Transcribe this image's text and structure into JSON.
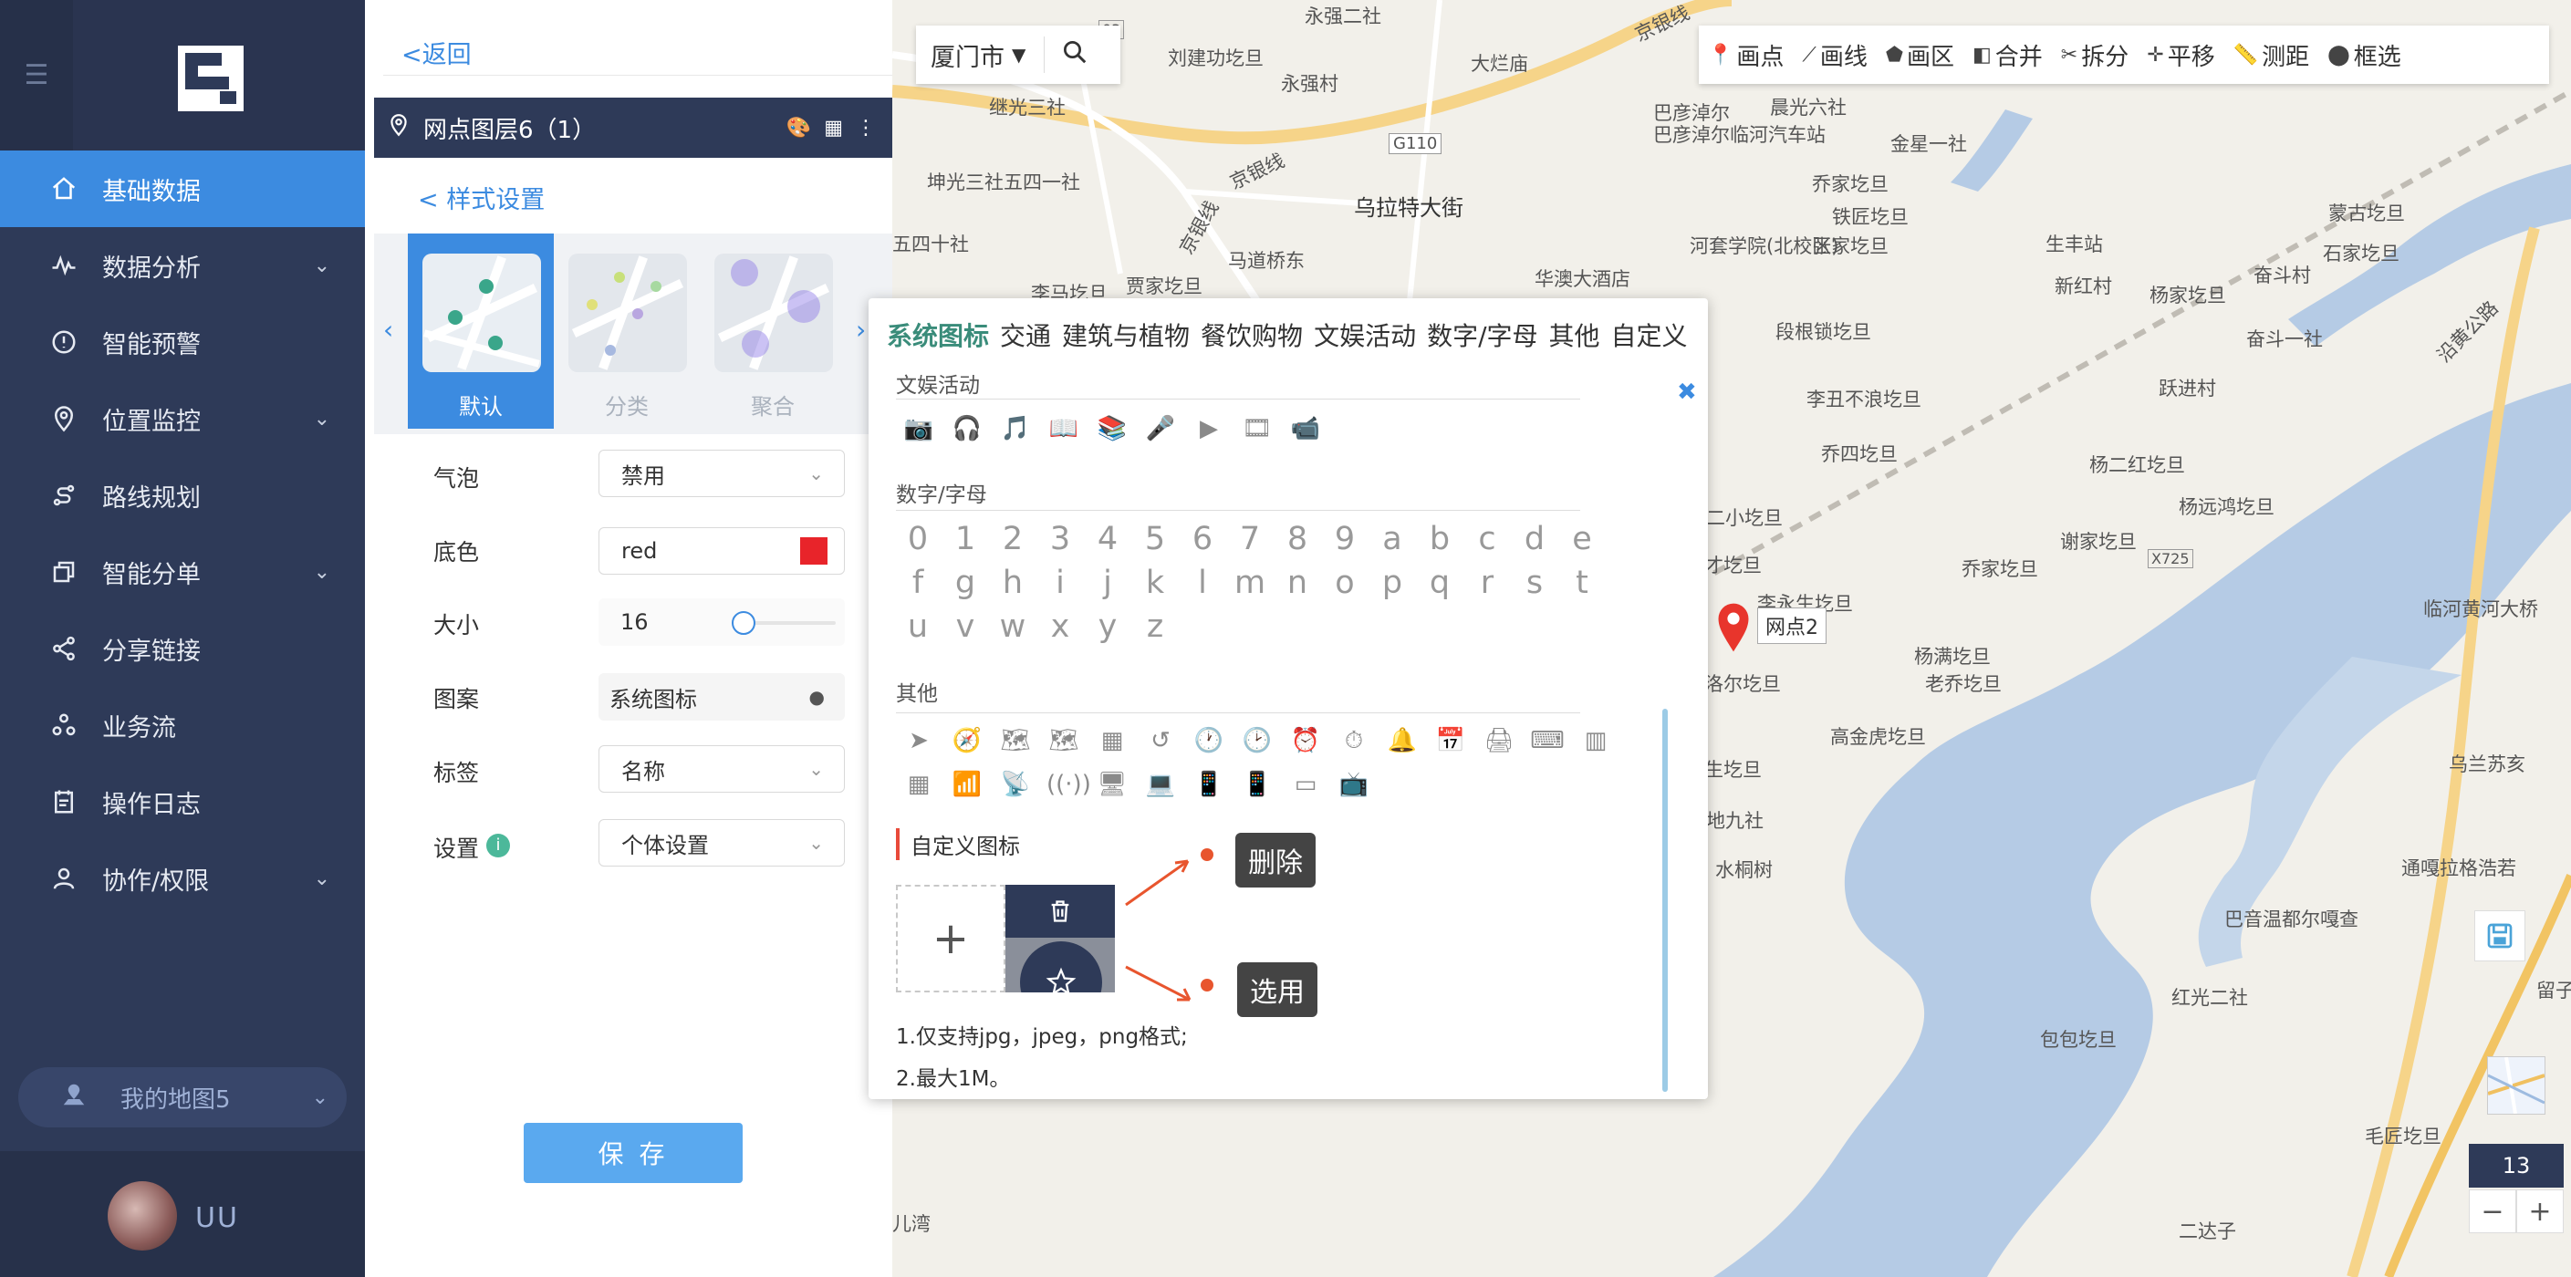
{
  "sidebar": {
    "items": [
      {
        "label": "基础数据",
        "icon": "home-icon",
        "active": true,
        "chevron": false
      },
      {
        "label": "数据分析",
        "icon": "analytics-icon",
        "active": false,
        "chevron": true
      },
      {
        "label": "智能预警",
        "icon": "alert-icon",
        "active": false,
        "chevron": false
      },
      {
        "label": "位置监控",
        "icon": "location-icon",
        "active": false,
        "chevron": true
      },
      {
        "label": "路线规划",
        "icon": "route-icon",
        "active": false,
        "chevron": false
      },
      {
        "label": "智能分单",
        "icon": "copy-icon",
        "active": false,
        "chevron": true
      },
      {
        "label": "分享链接",
        "icon": "share-icon",
        "active": false,
        "chevron": false
      },
      {
        "label": "业务流",
        "icon": "workflow-icon",
        "active": false,
        "chevron": false
      },
      {
        "label": "操作日志",
        "icon": "log-icon",
        "active": false,
        "chevron": false
      },
      {
        "label": "协作/权限",
        "icon": "user-icon",
        "active": false,
        "chevron": true
      }
    ],
    "my_map": "我的地图5",
    "username": "UU"
  },
  "panel": {
    "back": "<返回",
    "layer_title": "网点图层6（1）",
    "style_title": "< 样式设置",
    "styles": [
      {
        "label": "默认",
        "active": true
      },
      {
        "label": "分类",
        "active": false
      },
      {
        "label": "聚合",
        "active": false
      }
    ],
    "form": {
      "bubble_label": "气泡",
      "bubble_value": "禁用",
      "color_label": "底色",
      "color_value": "red",
      "swatch_color": "#e8242a",
      "size_label": "大小",
      "size_value": "16",
      "pattern_label": "图案",
      "pattern_value": "系统图标",
      "tag_label": "标签",
      "tag_value": "名称",
      "setting_label": "设置",
      "setting_value": "个体设置"
    },
    "save": "保 存"
  },
  "map": {
    "city": "厦门市",
    "tools": [
      {
        "label": "画点",
        "icon": "pin-icon"
      },
      {
        "label": "画线",
        "icon": "line-icon"
      },
      {
        "label": "画区",
        "icon": "polygon-icon"
      },
      {
        "label": "合并",
        "icon": "merge-icon"
      },
      {
        "label": "拆分",
        "icon": "split-icon"
      },
      {
        "label": "平移",
        "icon": "move-icon"
      },
      {
        "label": "测距",
        "icon": "ruler-icon"
      },
      {
        "label": "框选",
        "icon": "select-icon"
      }
    ],
    "marker_label": "网点2",
    "zoom": "13",
    "zoom_out": "−",
    "zoom_in": "+",
    "labels": {
      "l1": "永强二社",
      "l2": "京银线",
      "l3": "刘建功圪旦",
      "l4": "永强村",
      "l5": "大烂庙",
      "l6": "继光三社",
      "l7": "巴彦淖尔临河汽车站",
      "l8": "晨光六社",
      "l9": "金星一社",
      "l10": "G110",
      "l11": "坤光三社五四一社",
      "l12": "京银线",
      "l13": "乌拉特大街",
      "l14": "乔家圪旦",
      "l15": "铁匠圪旦",
      "l16": "蒙古圪旦",
      "l17": "石家圪旦",
      "l18": "五四十社",
      "l19": "马道桥东",
      "l20": "河套学院(北校区)",
      "l21": "张家圪旦",
      "l22": "生丰站",
      "l23": "李马圪旦",
      "l24": "贾家圪旦",
      "l25": "华澳大酒店",
      "l26": "新红村",
      "l27": "杨家圪旦",
      "l28": "奋斗村",
      "l29": "奋斗一社",
      "l30": "沿黄公路",
      "l31": "段根锁圪旦",
      "l32": "跃进村",
      "l33": "李丑不浪圪旦",
      "l34": "乔四圪旦",
      "l35": "杨二红圪旦",
      "l36": "二小圪旦",
      "l37": "杨远鸿圪旦",
      "l38": "谢家圪旦",
      "l39": "乔家圪旦",
      "l40": "X725",
      "l41": "才圪旦",
      "l42": "李永生圪旦",
      "l43": "临河黄河大桥",
      "l44": "杨满圪旦",
      "l45": "老乔圪旦",
      "l46": "洛尔圪旦",
      "l47": "高金虎圪旦",
      "l48": "乌兰苏亥",
      "l49": "生圪旦",
      "l50": "地九社",
      "l51": "水桐树",
      "l52": "通嘎拉格浩若",
      "l53": "巴音温都尔嘎查",
      "l54": "红光二社",
      "l55": "包包圪旦",
      "l56": "毛匠圪旦",
      "l57": "二达子",
      "l58": "儿湾",
      "l59": "留子",
      "l60": "03",
      "l61": "京银线",
      "l62": "巴彦淖尔"
    }
  },
  "picker": {
    "tabs": [
      "系统图标",
      "交通",
      "建筑与植物",
      "餐饮购物",
      "文娱活动",
      "数字/字母",
      "其他",
      "自定义"
    ],
    "section_ent": "文娱活动",
    "section_num": "数字/字母",
    "section_other": "其他",
    "close": "✖",
    "ent_icons": [
      "📷",
      "🎧",
      "🎵",
      "📖",
      "📚",
      "🎤",
      "▶",
      "🎞",
      "📹"
    ],
    "chars_row1": [
      "0",
      "1",
      "2",
      "3",
      "4",
      "5",
      "6",
      "7",
      "8",
      "9",
      "a",
      "b",
      "c",
      "d",
      "e"
    ],
    "chars_row2": [
      "f",
      "g",
      "h",
      "i",
      "j",
      "k",
      "l",
      "m",
      "n",
      "o",
      "p",
      "q",
      "r",
      "s",
      "t"
    ],
    "chars_row3": [
      "u",
      "v",
      "w",
      "x",
      "y",
      "z"
    ],
    "other_row1": [
      "➤",
      "🧭",
      "🗺",
      "🗺",
      "▦",
      "↺",
      "🕐",
      "🕑",
      "⏰",
      "⏱",
      "🔔",
      "📅",
      "🖨",
      "⌨",
      "▥"
    ],
    "other_row2": [
      "▦",
      "📶",
      "📡",
      "((·))",
      "🖥",
      "💻",
      "📱",
      "📱",
      "▭",
      "📺"
    ],
    "custom_title": "自定义图标",
    "upload_plus": "+",
    "note1": "1.仅支持jpg，jpeg，png格式;",
    "note2": "2.最大1M。"
  },
  "annotations": {
    "delete": "删除",
    "select": "选用"
  }
}
